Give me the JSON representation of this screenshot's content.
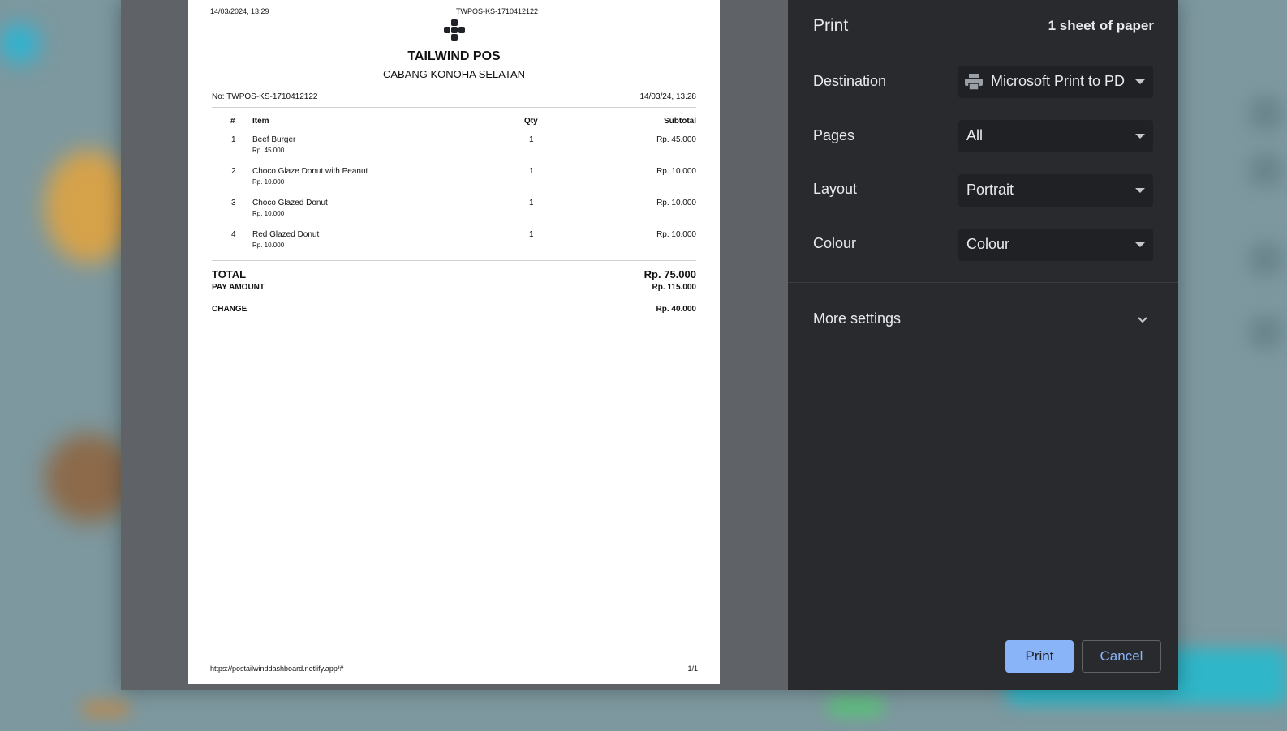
{
  "preview": {
    "header_datetime": "14/03/2024, 13:29",
    "header_title": "TWPOS-KS-1710412122",
    "store_name": "TAILWIND POS",
    "store_branch": "CABANG KONOHA SELATAN",
    "receipt_no": "No: TWPOS-KS-1710412122",
    "receipt_date": "14/03/24, 13.28",
    "columns": {
      "no": "#",
      "item": "Item",
      "qty": "Qty",
      "subtotal": "Subtotal"
    },
    "items": [
      {
        "no": "1",
        "name": "Beef Burger",
        "price": "Rp. 45.000",
        "qty": "1",
        "subtotal": "Rp. 45.000"
      },
      {
        "no": "2",
        "name": "Choco Glaze Donut with Peanut",
        "price": "Rp. 10.000",
        "qty": "1",
        "subtotal": "Rp. 10.000"
      },
      {
        "no": "3",
        "name": "Choco Glazed Donut",
        "price": "Rp. 10.000",
        "qty": "1",
        "subtotal": "Rp. 10.000"
      },
      {
        "no": "4",
        "name": "Red Glazed Donut",
        "price": "Rp. 10.000",
        "qty": "1",
        "subtotal": "Rp. 10.000"
      }
    ],
    "total_label": "TOTAL",
    "total_value": "Rp. 75.000",
    "pay_label": "PAY AMOUNT",
    "pay_value": "Rp. 115.000",
    "change_label": "CHANGE",
    "change_value": "Rp. 40.000",
    "footer_url": "https://postailwinddashboard.netlify.app/#",
    "footer_page": "1/1"
  },
  "panel": {
    "title": "Print",
    "sheets": "1 sheet of paper",
    "settings": [
      {
        "label": "Destination",
        "value": "Microsoft Print to PD"
      },
      {
        "label": "Pages",
        "value": "All"
      },
      {
        "label": "Layout",
        "value": "Portrait"
      },
      {
        "label": "Colour",
        "value": "Colour"
      }
    ],
    "more_settings": "More settings",
    "print_button": "Print",
    "cancel_button": "Cancel"
  }
}
